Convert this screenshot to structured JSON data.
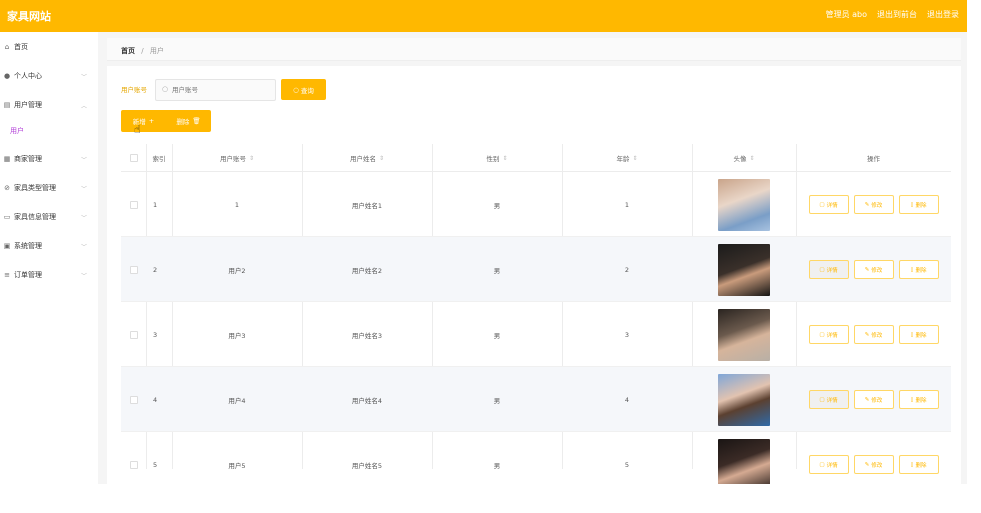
{
  "header": {
    "title": "家具网站",
    "user": "管理员 abo",
    "back_front": "退出到前台",
    "logout": "退出登录"
  },
  "sidebar": {
    "items": [
      {
        "label": "首页",
        "icon": "home-icon"
      },
      {
        "label": "个人中心",
        "icon": "user-icon"
      },
      {
        "label": "用户管理",
        "icon": "list-icon"
      },
      {
        "label": "用户",
        "icon": ""
      },
      {
        "label": "商家管理",
        "icon": "grid-icon"
      },
      {
        "label": "家具类型管理",
        "icon": "tag-icon"
      },
      {
        "label": "家具信息管理",
        "icon": "card-icon"
      },
      {
        "label": "系统管理",
        "icon": "settings-icon"
      },
      {
        "label": "订单管理",
        "icon": "menu-icon"
      }
    ]
  },
  "breadcrumb": {
    "home": "首页",
    "sep": "/",
    "current": "用户"
  },
  "search": {
    "label": "用户账号",
    "placeholder": "用户账号",
    "button": "查询"
  },
  "actions": {
    "add": "新增",
    "delete": "删除"
  },
  "table": {
    "headers": [
      "索引",
      "用户账号",
      "用户姓名",
      "性别",
      "年龄",
      "头像",
      "操作"
    ],
    "rows": [
      {
        "index": "1",
        "account": "1",
        "name": "用户姓名1",
        "gender": "男",
        "age": "1"
      },
      {
        "index": "2",
        "account": "用户2",
        "name": "用户姓名2",
        "gender": "男",
        "age": "2"
      },
      {
        "index": "3",
        "account": "用户3",
        "name": "用户姓名3",
        "gender": "男",
        "age": "3"
      },
      {
        "index": "4",
        "account": "用户4",
        "name": "用户姓名4",
        "gender": "男",
        "age": "4"
      },
      {
        "index": "5",
        "account": "用户5",
        "name": "用户姓名5",
        "gender": "男",
        "age": "5"
      }
    ],
    "op_labels": {
      "detail": "详情",
      "edit": "修改",
      "delete": "删除"
    }
  },
  "colors": {
    "accent": "#ffb800",
    "submenu_active": "#b341d8"
  }
}
